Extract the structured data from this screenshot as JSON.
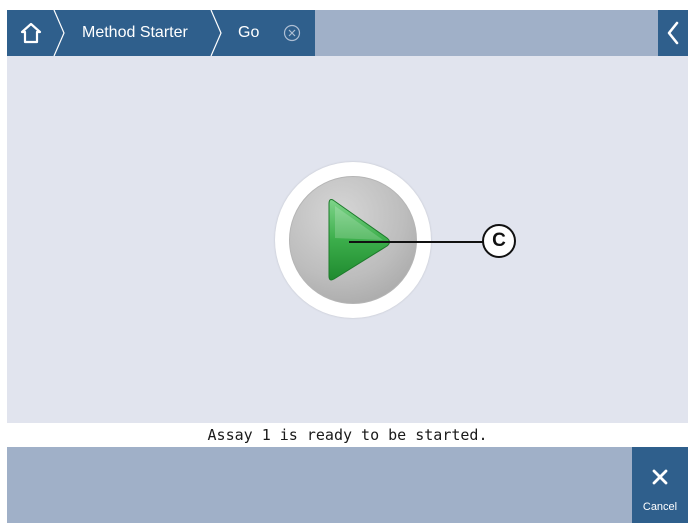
{
  "breadcrumb": {
    "items": [
      {
        "label": "Method Starter"
      },
      {
        "label": "Go"
      }
    ]
  },
  "icons": {
    "home": "home-icon",
    "close": "circle-close-icon",
    "back": "chevron-left-icon",
    "play": "play-icon",
    "cancel": "x-icon"
  },
  "callout": {
    "label": "C"
  },
  "status": {
    "text": "Assay 1 is ready to be started."
  },
  "cancel": {
    "label": "Cancel"
  },
  "colors": {
    "header_blue": "#2f5f8c",
    "bar_gray_blue": "#a0b0c8",
    "content_bg": "#e1e4ee",
    "play_green": "#2e9e3e"
  }
}
